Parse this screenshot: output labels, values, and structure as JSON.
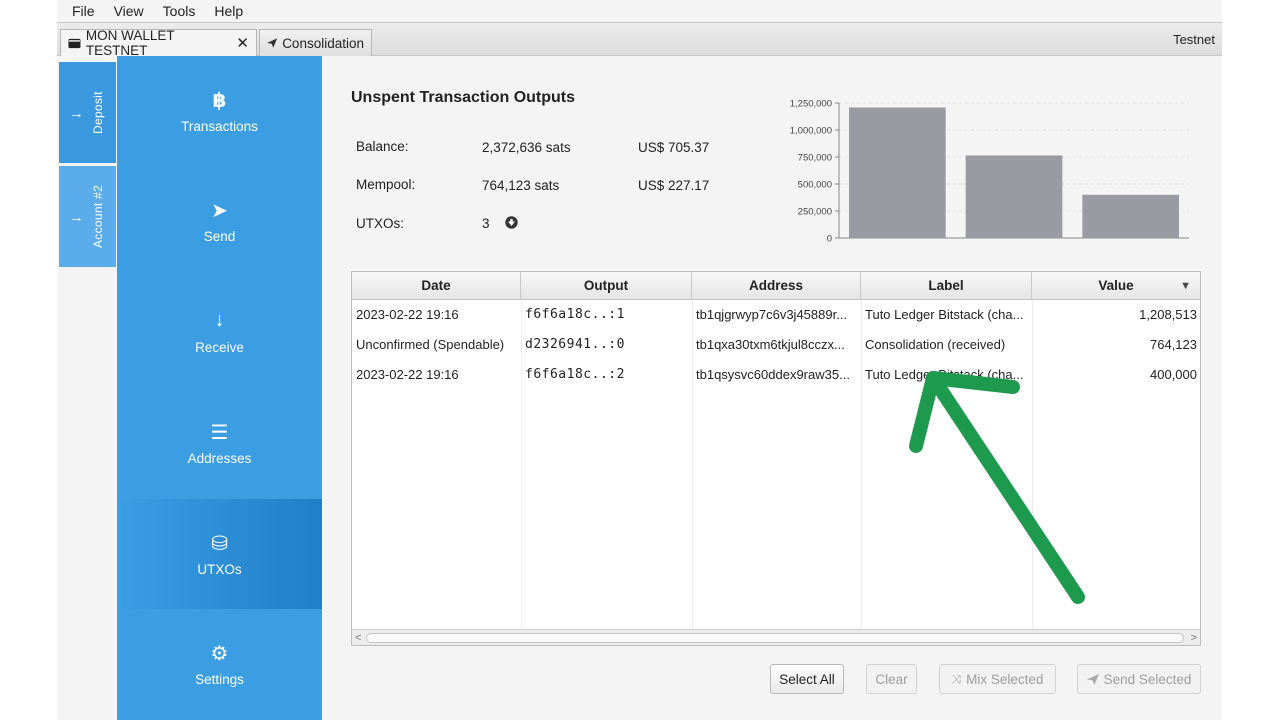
{
  "menu": [
    "File",
    "View",
    "Tools",
    "Help"
  ],
  "tabs": {
    "wallet_tab": "MON WALLET TESTNET",
    "close_glyph": "✕",
    "consolidation_tab": "Consolidation",
    "network": "Testnet"
  },
  "accounts": [
    {
      "label": "Deposit"
    },
    {
      "label": "Account #2"
    }
  ],
  "nav": [
    {
      "label": "Transactions",
      "icon": "bitcoin-icon",
      "glyph": "฿"
    },
    {
      "label": "Send",
      "icon": "send-icon",
      "glyph": "➤"
    },
    {
      "label": "Receive",
      "icon": "receive-icon",
      "glyph": "↓"
    },
    {
      "label": "Addresses",
      "icon": "list-icon",
      "glyph": "☰"
    },
    {
      "label": "UTXOs",
      "icon": "coins-icon",
      "glyph": "⛁"
    },
    {
      "label": "Settings",
      "icon": "gear-icon",
      "glyph": "⚙"
    }
  ],
  "summary": {
    "title": "Unspent Transaction Outputs",
    "balance_label": "Balance:",
    "balance_sats": "2,372,636 sats",
    "balance_usd": "US$ 705.37",
    "mempool_label": "Mempool:",
    "mempool_sats": "764,123 sats",
    "mempool_usd": "US$ 227.17",
    "utxos_label": "UTXOs:",
    "utxos_count": "3"
  },
  "chart_data": {
    "type": "bar",
    "categories": [
      "f6f6a18c..:1",
      "d2326941..:0",
      "f6f6a18c..:2"
    ],
    "values": [
      1208513,
      764123,
      400000
    ],
    "yticks": [
      "0",
      "250,000",
      "500,000",
      "750,000",
      "1,000,000",
      "1,250,000"
    ],
    "ylim": [
      0,
      1250000
    ],
    "grid": true,
    "bar_color": "#9a9aa2"
  },
  "table": {
    "columns": [
      "Date",
      "Output",
      "Address",
      "Label",
      "Value"
    ],
    "sort_glyph": "▼",
    "rows": [
      {
        "date": "2023-02-22 19:16",
        "output": "f6f6a18c..:1",
        "address": "tb1qjgrwyp7c6v3j45889r...",
        "label": "Tuto Ledger Bitstack (cha...",
        "value": "1,208,513"
      },
      {
        "date": "Unconfirmed (Spendable)",
        "output": "d2326941..:0",
        "address": "tb1qxa30txm6tkjul8cczx...",
        "label": "Consolidation (received)",
        "value": "764,123"
      },
      {
        "date": "2023-02-22 19:16",
        "output": "f6f6a18c..:2",
        "address": "tb1qsysvc60ddex9raw35...",
        "label": "Tuto Ledger Bitstack (cha...",
        "value": "400,000"
      }
    ]
  },
  "buttons": {
    "select_all": "Select All",
    "clear": "Clear",
    "mix_selected": "Mix Selected",
    "send_selected": "Send Selected"
  },
  "colors": {
    "nav_blue": "#3b9ee3",
    "annotation_arrow": "#1e9a4e"
  }
}
